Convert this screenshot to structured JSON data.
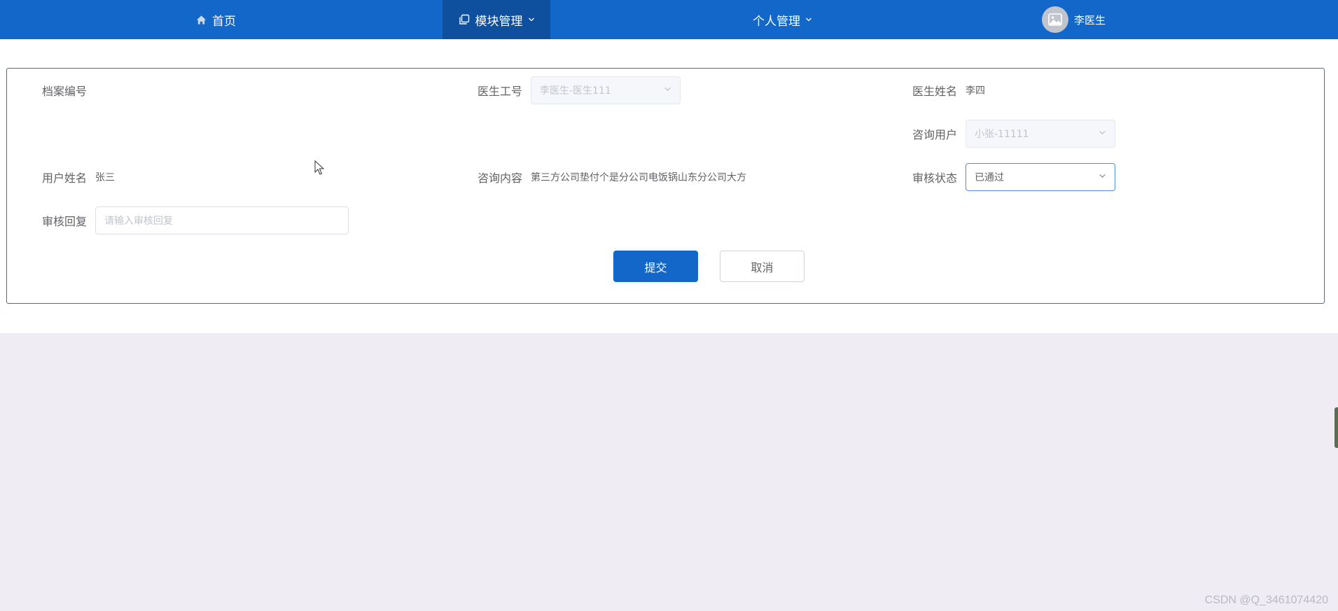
{
  "nav": {
    "home_label": "首页",
    "module_label": "模块管理",
    "personal_label": "个人管理",
    "user_name": "李医生"
  },
  "form": {
    "archive_no": {
      "label": "档案编号",
      "value": ""
    },
    "doctor_id": {
      "label": "医生工号",
      "value": "李医生-医生111"
    },
    "doctor_name": {
      "label": "医生姓名",
      "value": "李四"
    },
    "consult_user": {
      "label": "咨询用户",
      "value": "小张-11111"
    },
    "user_name": {
      "label": "用户姓名",
      "value": "张三"
    },
    "consult_content": {
      "label": "咨询内容",
      "value": "第三方公司垫付个是分公司电饭锅山东分公司大方"
    },
    "review_status": {
      "label": "审核状态",
      "value": "已通过"
    },
    "review_reply": {
      "label": "审核回复",
      "placeholder": "请输入审核回复"
    }
  },
  "actions": {
    "submit_label": "提交",
    "cancel_label": "取消"
  },
  "watermark": "CSDN @Q_3461074420",
  "colors": {
    "nav_bg": "#1367c8",
    "nav_active": "#0e4f9e",
    "primary": "#1367c8",
    "page_bg": "#efedf3"
  }
}
